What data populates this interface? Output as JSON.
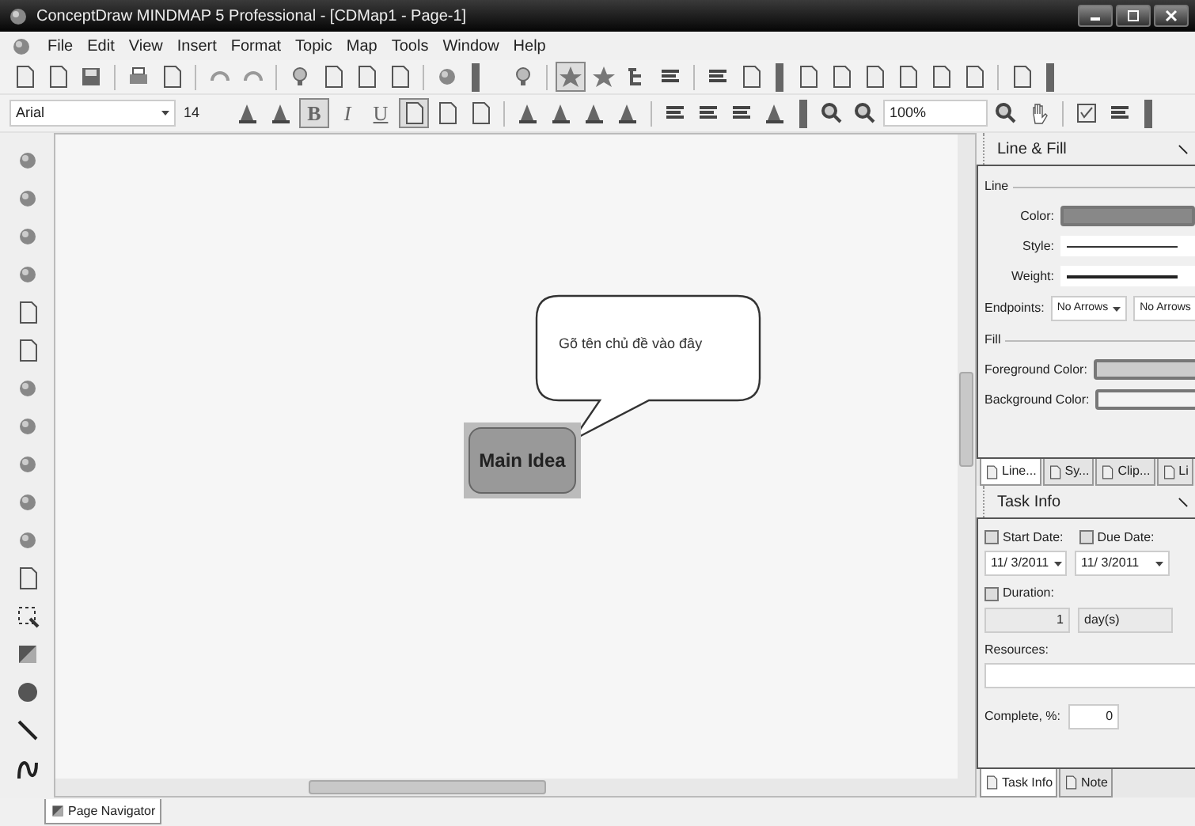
{
  "window": {
    "title": "ConceptDraw MINDMAP 5 Professional - [CDMap1 - Page-1]"
  },
  "menu": [
    "File",
    "Edit",
    "View",
    "Insert",
    "Format",
    "Topic",
    "Map",
    "Tools",
    "Window",
    "Help"
  ],
  "font": {
    "name": "Arial",
    "size": "14"
  },
  "format_buttons": [
    {
      "label": "B",
      "pressed": true
    },
    {
      "label": "I",
      "pressed": false
    },
    {
      "label": "U",
      "pressed": false
    }
  ],
  "zoom": "100%",
  "canvas": {
    "main_topic": "Main Idea",
    "callout": "Gõ tên chủ đề vào đây"
  },
  "line_fill": {
    "title": "Line & Fill",
    "line_group": "Line",
    "color_label": "Color:",
    "style_label": "Style:",
    "weight_label": "Weight:",
    "endpoints_label": "Endpoints:",
    "endpoint_start": "No Arrows",
    "endpoint_end": "No Arrows",
    "fill_group": "Fill",
    "foreground_label": "Foreground Color:",
    "background_label": "Background Color:"
  },
  "panel_tabs": [
    {
      "label": "Line...",
      "selected": true
    },
    {
      "label": "Sy...",
      "selected": false
    },
    {
      "label": "Clip...",
      "selected": false
    },
    {
      "label": "Li",
      "selected": false
    }
  ],
  "task_info": {
    "title": "Task Info",
    "start_date": {
      "label": "Start Date:",
      "checked": false,
      "value": "11/ 3/2011"
    },
    "due_date": {
      "label": "Due Date:",
      "checked": false,
      "value": "11/ 3/2011"
    },
    "duration": {
      "label": "Duration:",
      "checked": false,
      "value": "1",
      "unit": "day(s)"
    },
    "resources_label": "Resources:",
    "complete_label": "Complete, %:",
    "complete_value": "0"
  },
  "bottom_tabs": [
    {
      "label": "Task Info",
      "selected": true
    },
    {
      "label": "Note",
      "selected": false
    }
  ],
  "page_tab": "Page Navigator"
}
